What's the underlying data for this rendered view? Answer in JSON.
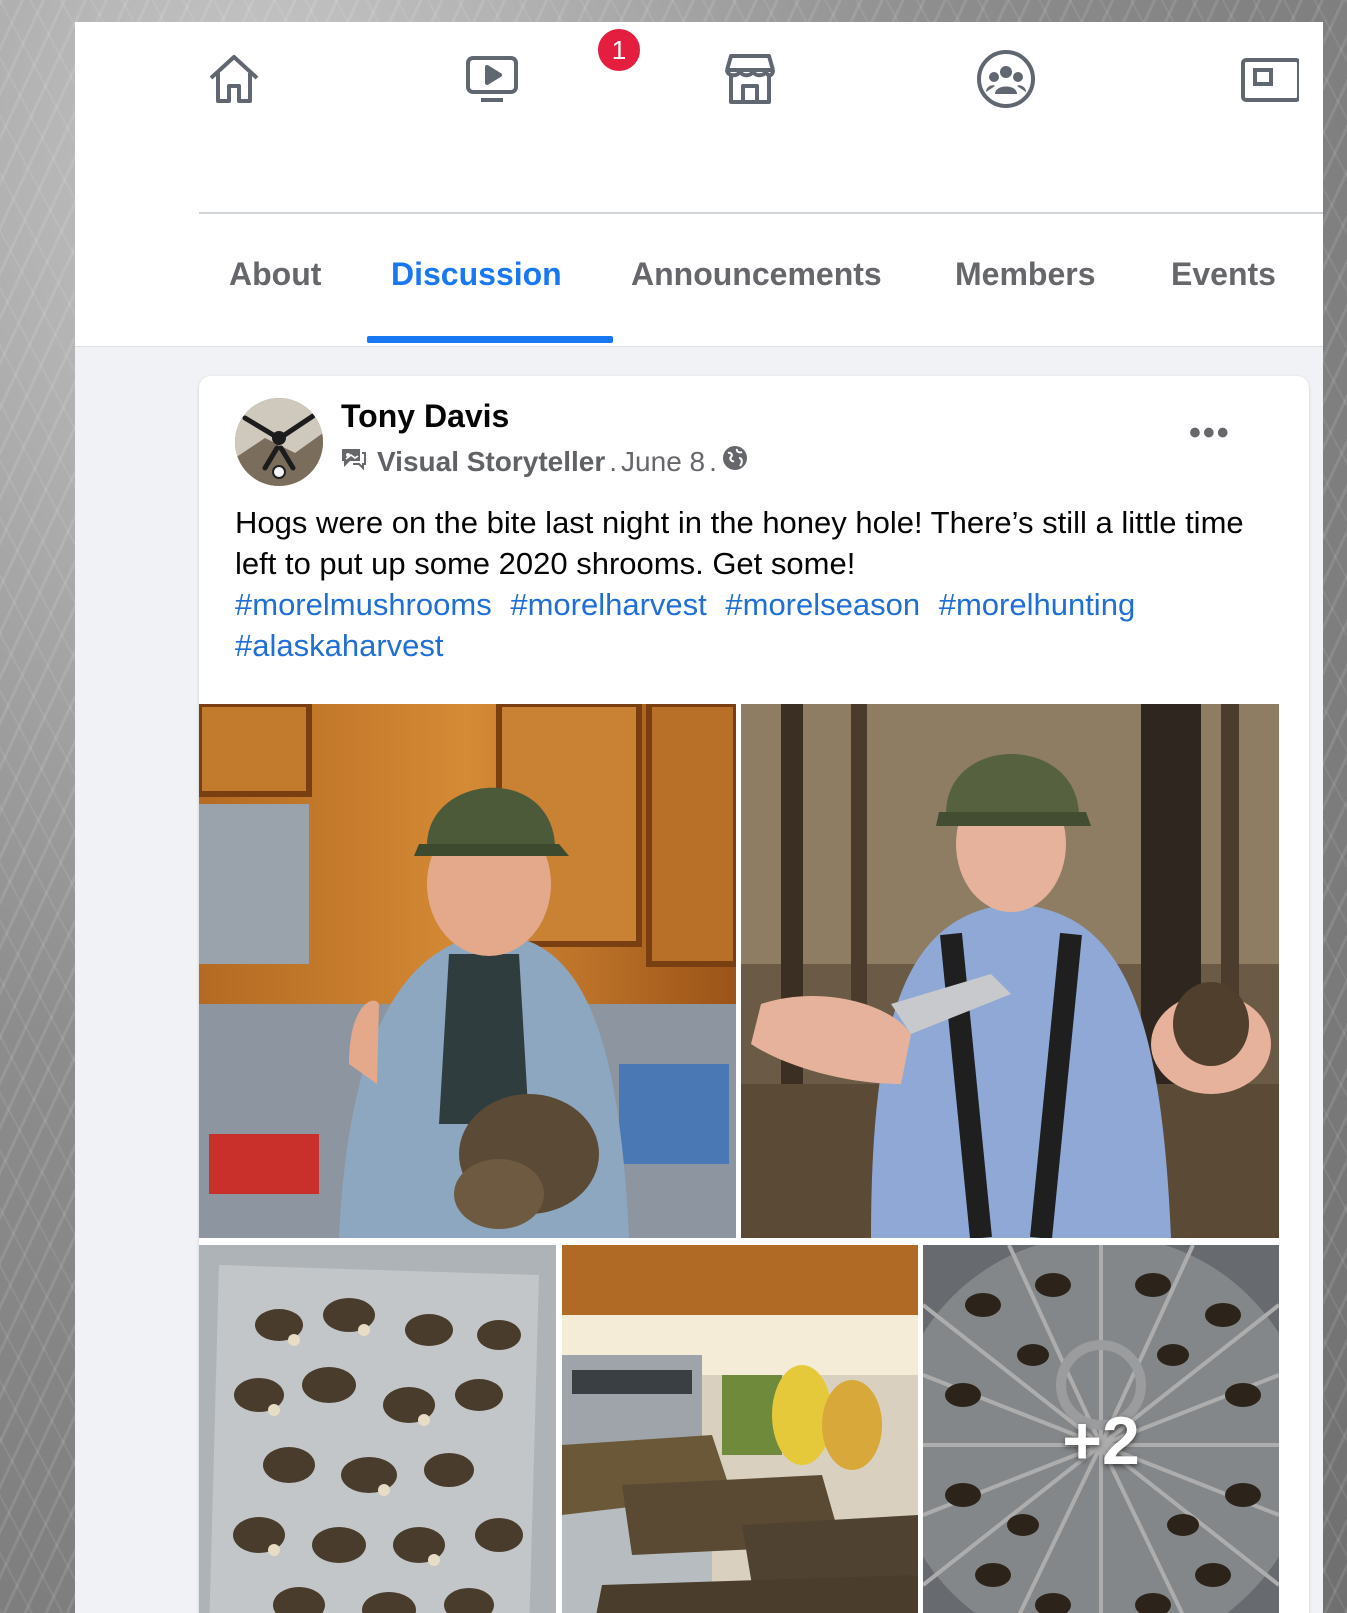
{
  "nav": {
    "items": [
      {
        "name": "home-icon"
      },
      {
        "name": "watch-icon",
        "badge": "1"
      },
      {
        "name": "marketplace-icon"
      },
      {
        "name": "groups-icon"
      },
      {
        "name": "gaming-icon"
      }
    ]
  },
  "tabs": [
    {
      "label": "About"
    },
    {
      "label": "Discussion",
      "active": true
    },
    {
      "label": "Announcements"
    },
    {
      "label": "Members"
    },
    {
      "label": "Events"
    }
  ],
  "post": {
    "author": "Tony Davis",
    "role": "Visual Storyteller",
    "date": "June 8",
    "sep1": ".",
    "sep2": ".",
    "more": "•••",
    "text": "Hogs were on the bite last night in the honey hole! There’s still a little time left to put up some 2020 shrooms. Get some!",
    "hashtags": [
      "#morelmushrooms",
      "#morelharvest",
      "#morelseason",
      "#morelhunting",
      "#alaskaharvest"
    ],
    "extra_photos": "+2"
  },
  "colors": {
    "accent": "#1877f2",
    "badge": "#e41e3f",
    "hashtag": "#1f6fd6"
  }
}
